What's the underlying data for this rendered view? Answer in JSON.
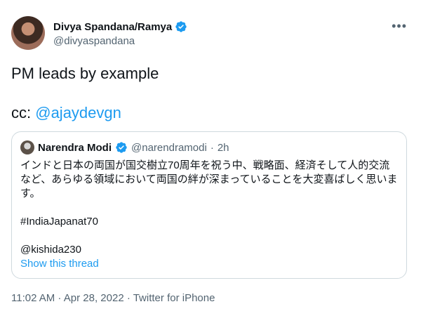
{
  "author": {
    "display_name": "Divya Spandana/Ramya",
    "handle": "@divyaspandana"
  },
  "tweet": {
    "line1": "PM leads by example",
    "cc_prefix": "cc: ",
    "cc_mention": "@ajaydevgn"
  },
  "quoted": {
    "display_name": "Narendra Modi",
    "handle": "@narendramodi",
    "separator": "·",
    "time": "2h",
    "text_line1": "インドと日本の両国が国交樹立70周年を祝う中、戦略面、経済そして人的交流",
    "text_line2": "など、あらゆる領域において両国の絆が深まっていることを大変喜ばしく思いま",
    "text_line3": "す。",
    "hashtag": "#IndiaJapanat70",
    "mention": "@kishida230",
    "show_thread": "Show this thread"
  },
  "timestamp": "11:02 AM · Apr 28, 2022 · Twitter for iPhone",
  "icons": {
    "verified": "verified-badge-icon",
    "more": "more-options-icon"
  },
  "colors": {
    "accent": "#1d9bf0",
    "secondary_text": "#536471",
    "primary_text": "#0f1419",
    "border": "#cfd9de"
  }
}
